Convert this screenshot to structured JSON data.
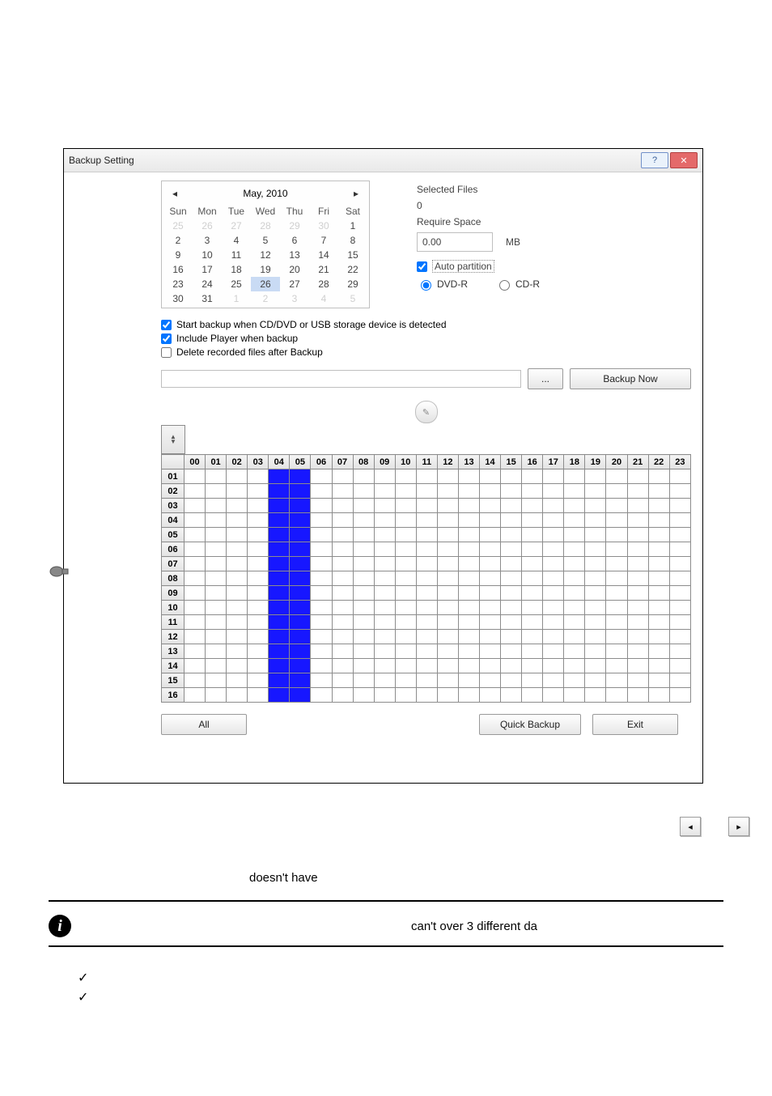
{
  "dialog": {
    "title": "Backup Setting",
    "help_label": "?",
    "close_label": "✕"
  },
  "calendar": {
    "month_label": "May, 2010",
    "weekdays": [
      "Sun",
      "Mon",
      "Tue",
      "Wed",
      "Thu",
      "Fri",
      "Sat"
    ],
    "rows": [
      [
        {
          "d": "25",
          "dim": true
        },
        {
          "d": "26",
          "dim": true
        },
        {
          "d": "27",
          "dim": true
        },
        {
          "d": "28",
          "dim": true
        },
        {
          "d": "29",
          "dim": true
        },
        {
          "d": "30",
          "dim": true
        },
        {
          "d": "1"
        }
      ],
      [
        {
          "d": "2"
        },
        {
          "d": "3"
        },
        {
          "d": "4"
        },
        {
          "d": "5"
        },
        {
          "d": "6"
        },
        {
          "d": "7"
        },
        {
          "d": "8"
        }
      ],
      [
        {
          "d": "9"
        },
        {
          "d": "10"
        },
        {
          "d": "11"
        },
        {
          "d": "12"
        },
        {
          "d": "13"
        },
        {
          "d": "14"
        },
        {
          "d": "15"
        }
      ],
      [
        {
          "d": "16"
        },
        {
          "d": "17"
        },
        {
          "d": "18"
        },
        {
          "d": "19"
        },
        {
          "d": "20"
        },
        {
          "d": "21"
        },
        {
          "d": "22"
        }
      ],
      [
        {
          "d": "23"
        },
        {
          "d": "24"
        },
        {
          "d": "25"
        },
        {
          "d": "26",
          "sel": true
        },
        {
          "d": "27"
        },
        {
          "d": "28"
        },
        {
          "d": "29"
        }
      ],
      [
        {
          "d": "30"
        },
        {
          "d": "31"
        },
        {
          "d": "1",
          "dim": true
        },
        {
          "d": "2",
          "dim": true
        },
        {
          "d": "3",
          "dim": true
        },
        {
          "d": "4",
          "dim": true
        },
        {
          "d": "5",
          "dim": true
        }
      ]
    ]
  },
  "summary": {
    "selected_files_label": "Selected Files",
    "selected_files_value": "0",
    "require_space_label": "Require Space",
    "require_space_value": "0.00",
    "space_unit": "MB",
    "auto_partition_label": "Auto partition",
    "auto_partition_checked": true,
    "media": {
      "dvd_label": "DVD-R",
      "cd_label": "CD-R",
      "selected": "dvd"
    }
  },
  "options": {
    "opt_start_label": "Start backup when CD/DVD or USB storage device is detected",
    "opt_start_checked": true,
    "opt_player_label": "Include Player when backup",
    "opt_player_checked": true,
    "opt_delete_label": "Delete recorded files after Backup",
    "opt_delete_checked": false
  },
  "path_browse_label": "...",
  "backup_now_label": "Backup Now",
  "grid": {
    "hours": [
      "00",
      "01",
      "02",
      "03",
      "04",
      "05",
      "06",
      "07",
      "08",
      "09",
      "10",
      "11",
      "12",
      "13",
      "14",
      "15",
      "16",
      "17",
      "18",
      "19",
      "20",
      "21",
      "22",
      "23"
    ],
    "rows": [
      "01",
      "02",
      "03",
      "04",
      "05",
      "06",
      "07",
      "08",
      "09",
      "10",
      "11",
      "12",
      "13",
      "14",
      "15",
      "16"
    ],
    "blue_hours": [
      "04",
      "05"
    ]
  },
  "buttons": {
    "all": "All",
    "quick": "Quick Backup",
    "exit": "Exit"
  },
  "page_text": {
    "loose1": "doesn't have",
    "loose2": "can't over 3 different da"
  }
}
